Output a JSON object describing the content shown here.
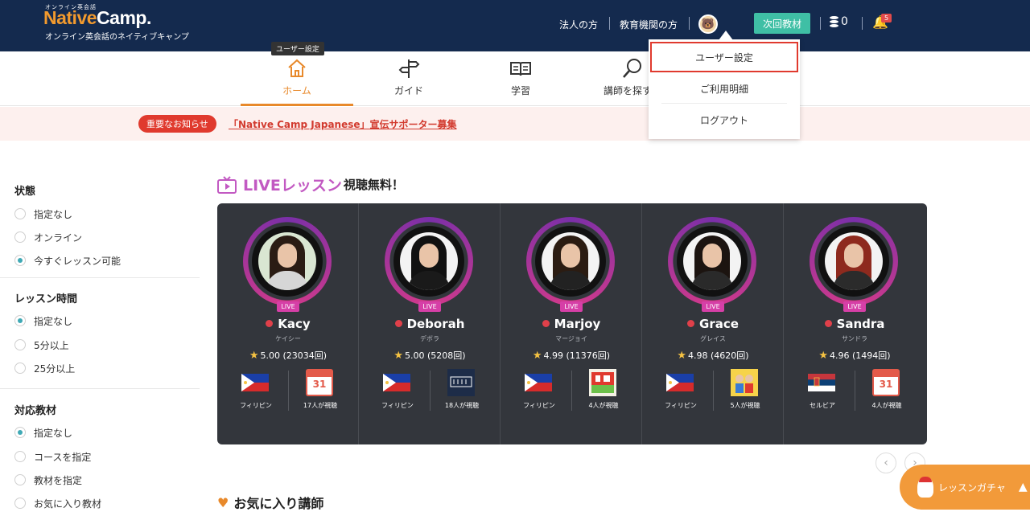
{
  "header": {
    "logo_small": "オンライン英会話",
    "logo_native": "Native",
    "logo_camp": "Camp.",
    "tagline": "オンライン英会話のネイティブキャンプ",
    "link_corporate": "法人の方",
    "link_education": "教育機関の方",
    "next_material": "次回教材",
    "coins": "0",
    "notifications": "5"
  },
  "nav": {
    "tooltip": "ユーザー設定",
    "items": [
      {
        "label": "ホーム"
      },
      {
        "label": "ガイド"
      },
      {
        "label": "学習"
      },
      {
        "label": "講師を探す・"
      }
    ]
  },
  "notice": {
    "badge": "重要なお知らせ",
    "link": "「Native Camp Japanese」宣伝サポーター募集"
  },
  "sidebar": {
    "status": {
      "title": "状態",
      "options": [
        "指定なし",
        "オンライン",
        "今すぐレッスン可能"
      ]
    },
    "time": {
      "title": "レッスン時間",
      "options": [
        "指定なし",
        "5分以上",
        "25分以上"
      ]
    },
    "material": {
      "title": "対応教材",
      "options": [
        "指定なし",
        "コースを指定",
        "教材を指定",
        "お気に入り教材"
      ]
    }
  },
  "live": {
    "title_big": "LIVEレッスン",
    "title_small": "視聴無料！",
    "badge": "LIVE",
    "teachers": [
      {
        "name": "Kacy",
        "kana": "ケイシー",
        "rating": "5.00 (23034回)",
        "country": "フィリピン",
        "viewers": "17人が視聴",
        "material": "calendar"
      },
      {
        "name": "Deborah",
        "kana": "デボラ",
        "rating": "5.00 (5208回)",
        "country": "フィリピン",
        "viewers": "18人が視聴",
        "material": "callan"
      },
      {
        "name": "Marjoy",
        "kana": "マージョイ",
        "rating": "4.99 (11376回)",
        "country": "フィリピン",
        "viewers": "4人が視聴",
        "material": "letsgo"
      },
      {
        "name": "Grace",
        "kana": "グレイス",
        "rating": "4.98 (4620回)",
        "country": "フィリピン",
        "viewers": "5人が視聴",
        "material": "kids"
      },
      {
        "name": "Sandra",
        "kana": "サンドラ",
        "rating": "4.96 (1494回)",
        "country": "セルビア",
        "viewers": "4人が視聴",
        "material": "calendar"
      }
    ],
    "calendar_day": "31"
  },
  "favorites": {
    "title": "お気に入り講師"
  },
  "gacha": {
    "label": "レッスンガチャ"
  },
  "dropdown": {
    "items": [
      "ユーザー設定",
      "ご利用明細",
      "ログアウト"
    ]
  }
}
